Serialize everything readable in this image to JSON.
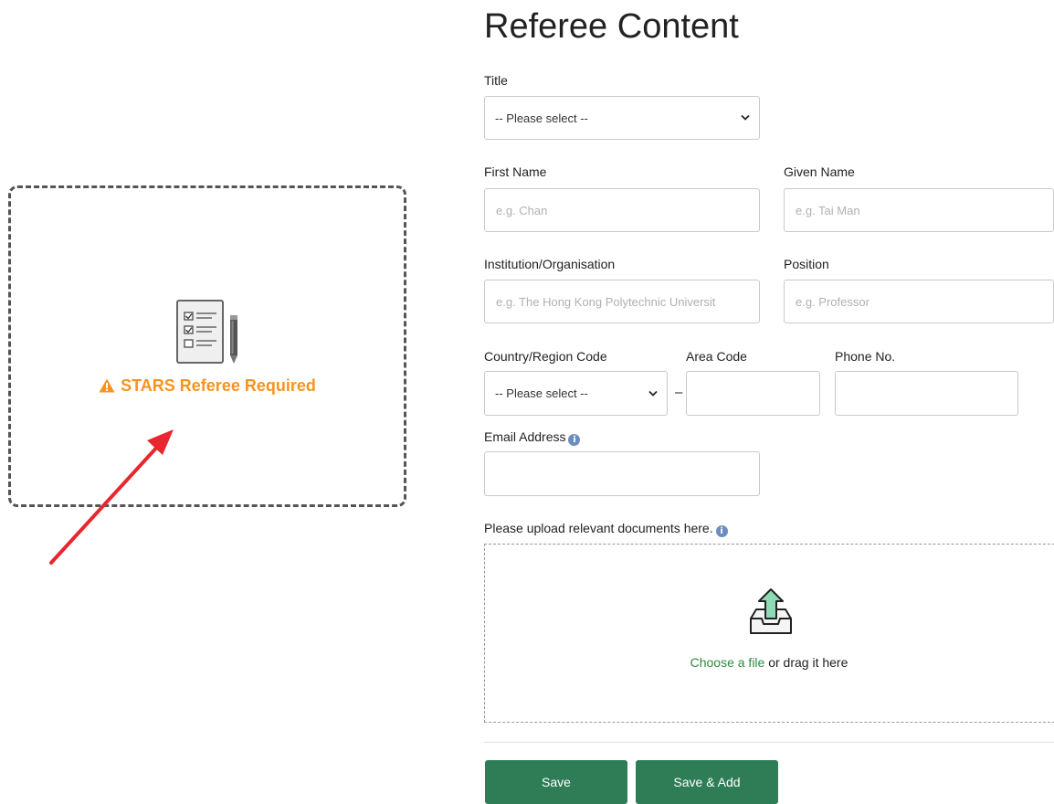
{
  "stars_card": {
    "warning_text": "STARS Referee Required"
  },
  "form": {
    "title": "Referee Content",
    "title_field": {
      "label": "Title",
      "selected": "-- Please select --"
    },
    "first_name": {
      "label": "First Name",
      "placeholder": "e.g. Chan",
      "value": ""
    },
    "given_name": {
      "label": "Given Name",
      "placeholder": "e.g. Tai Man",
      "value": ""
    },
    "institution": {
      "label": "Institution/Organisation",
      "placeholder": "e.g. The Hong Kong Polytechnic Universit",
      "value": ""
    },
    "position": {
      "label": "Position",
      "placeholder": "e.g. Professor",
      "value": ""
    },
    "country_code": {
      "label": "Country/Region Code",
      "selected": "-- Please select --"
    },
    "area_code": {
      "label": "Area Code",
      "value": ""
    },
    "phone_no": {
      "label": "Phone No.",
      "value": ""
    },
    "separator": "–",
    "email": {
      "label": "Email Address",
      "value": ""
    },
    "info_glyph": "i",
    "upload": {
      "label": "Please upload relevant documents here.",
      "choose_link": "Choose a file",
      "drag_text": " or drag it here"
    },
    "buttons": {
      "save": "Save",
      "save_add": "Save & Add"
    }
  },
  "colors": {
    "warning": "#f7931e",
    "button": "#2e7d56",
    "link": "#2e8b3e",
    "annotation_arrow": "#e8262e",
    "info": "#6c8ebf"
  },
  "icons": [
    "checklist-document-icon",
    "pencil-icon",
    "warning-icon",
    "chevron-down-icon",
    "info-icon",
    "upload-tray-icon",
    "annotation-arrow"
  ]
}
